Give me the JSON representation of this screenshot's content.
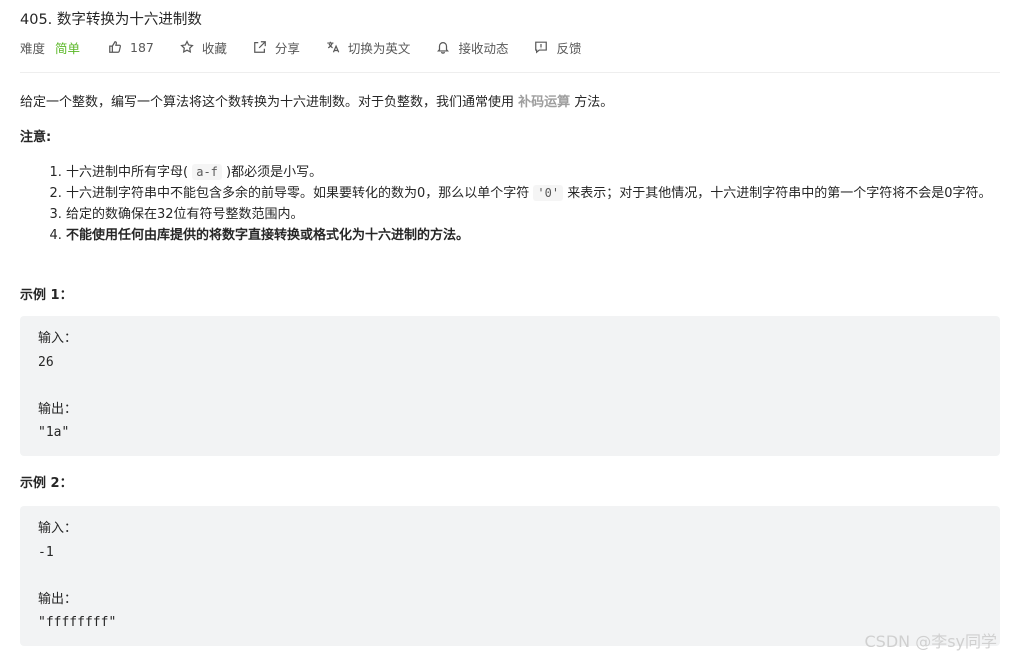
{
  "problem": {
    "title": "405. 数字转换为十六进制数",
    "difficulty_label": "难度",
    "difficulty_value": "简单",
    "likes": "187",
    "actions": {
      "favorite": "收藏",
      "share": "分享",
      "switch_lang": "切换为英文",
      "subscribe": "接收动态",
      "feedback": "反馈"
    },
    "intro_before": "给定一个整数，编写一个算法将这个数转换为十六进制数。对于负整数，我们通常使用 ",
    "intro_link": "补码运算",
    "intro_after": " 方法。",
    "note_heading": "注意:",
    "rules": {
      "r1_before": "十六进制中所有字母(",
      "r1_code": "a-f",
      "r1_after": ")都必须是小写。",
      "r2_before": "十六进制字符串中不能包含多余的前导零。如果要转化的数为0，那么以单个字符",
      "r2_code": "'0'",
      "r2_after": "来表示；对于其他情况，十六进制字符串中的第一个字符将不会是0字符。",
      "r3": "给定的数确保在32位有符号整数范围内。",
      "r4": "不能使用任何由库提供的将数字直接转换或格式化为十六进制的方法。"
    },
    "examples": [
      {
        "heading": "示例 1：",
        "input_label": "输入：",
        "input": "26",
        "output_label": "输出：",
        "output": "\"1a\""
      },
      {
        "heading": "示例 2：",
        "input_label": "输入：",
        "input": "-1",
        "output_label": "输出：",
        "output": "\"ffffffff\""
      }
    ]
  },
  "watermark": "CSDN @李sy同学",
  "colors": {
    "difficulty_easy": "#5ab726",
    "link": "#9e9e9e",
    "code_bg": "#f2f3f4"
  },
  "icons": [
    "thumbs-up-icon",
    "star-icon",
    "share-icon",
    "translate-icon",
    "bell-icon",
    "feedback-icon"
  ]
}
